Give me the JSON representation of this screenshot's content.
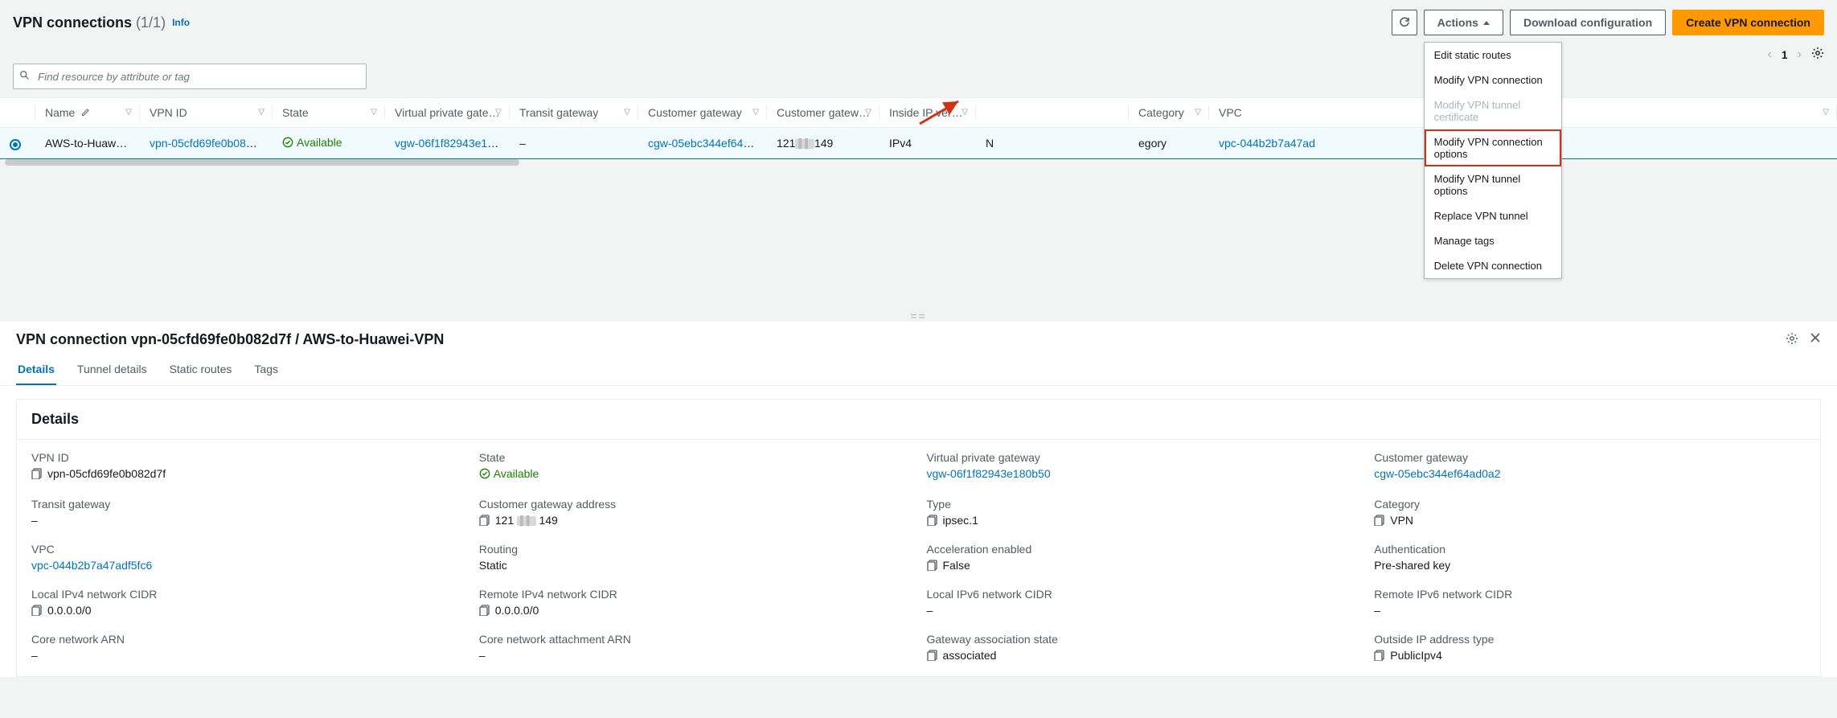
{
  "header": {
    "title": "VPN connections",
    "count": "(1/1)",
    "info": "Info",
    "search_placeholder": "Find resource by attribute or tag",
    "pager": {
      "page": "1"
    }
  },
  "toolbar": {
    "actions": "Actions",
    "download": "Download configuration",
    "create": "Create VPN connection"
  },
  "actions_menu": [
    {
      "label": "Edit static routes",
      "disabled": false
    },
    {
      "label": "Modify VPN connection",
      "disabled": false
    },
    {
      "label": "Modify VPN tunnel certificate",
      "disabled": true
    },
    {
      "label": "Modify VPN connection options",
      "disabled": false,
      "highlight": true
    },
    {
      "label": "Modify VPN tunnel options",
      "disabled": false
    },
    {
      "label": "Replace VPN tunnel",
      "disabled": false
    },
    {
      "label": "Manage tags",
      "disabled": false
    },
    {
      "label": "Delete VPN connection",
      "disabled": false
    }
  ],
  "columns": [
    "Name",
    "VPN ID",
    "State",
    "Virtual private gateway",
    "Transit gateway",
    "Customer gateway",
    "Customer gateway add...",
    "Inside IP version",
    "",
    "Category",
    "VPC"
  ],
  "row": {
    "name": "AWS-to-Huawei-VPN",
    "vpn_id": "vpn-05cfd69fe0b082d7f",
    "state": "Available",
    "vgw": "vgw-06f1f82943e180b50",
    "tgw": "–",
    "cgw": "cgw-05ebc344ef64ad0a2",
    "cgw_addr_a": "121",
    "cgw_addr_b": "149",
    "inside_ip": "IPv4",
    "category_char": "N",
    "category": "egory",
    "vpc": "vpc-044b2b7a47ad"
  },
  "detail": {
    "title": "VPN connection vpn-05cfd69fe0b082d7f / AWS-to-Huawei-VPN",
    "tabs": [
      "Details",
      "Tunnel details",
      "Static routes",
      "Tags"
    ],
    "panel_title": "Details",
    "items": [
      {
        "k": "VPN ID",
        "v": "vpn-05cfd69fe0b082d7f",
        "copy": true
      },
      {
        "k": "State",
        "v": "Available",
        "status": true
      },
      {
        "k": "Virtual private gateway",
        "v": "vgw-06f1f82943e180b50",
        "link": true
      },
      {
        "k": "Customer gateway",
        "v": "cgw-05ebc344ef64ad0a2",
        "link": true
      },
      {
        "k": "Transit gateway",
        "v": "–"
      },
      {
        "k": "Customer gateway address",
        "v": "121  149",
        "copy": true,
        "redact": true,
        "pre": "121",
        "post": "149"
      },
      {
        "k": "Type",
        "v": "ipsec.1",
        "copy": true
      },
      {
        "k": "Category",
        "v": "VPN",
        "copy": true
      },
      {
        "k": "VPC",
        "v": "vpc-044b2b7a47adf5fc6",
        "link": true
      },
      {
        "k": "Routing",
        "v": "Static"
      },
      {
        "k": "Acceleration enabled",
        "v": "False",
        "copy": true
      },
      {
        "k": "Authentication",
        "v": "Pre-shared key"
      },
      {
        "k": "Local IPv4 network CIDR",
        "v": "0.0.0.0/0",
        "copy": true
      },
      {
        "k": "Remote IPv4 network CIDR",
        "v": "0.0.0.0/0",
        "copy": true
      },
      {
        "k": "Local IPv6 network CIDR",
        "v": "–"
      },
      {
        "k": "Remote IPv6 network CIDR",
        "v": "–"
      },
      {
        "k": "Core network ARN",
        "v": "–"
      },
      {
        "k": "Core network attachment ARN",
        "v": "–"
      },
      {
        "k": "Gateway association state",
        "v": "associated",
        "copy": true
      },
      {
        "k": "Outside IP address type",
        "v": "PublicIpv4",
        "copy": true
      }
    ]
  }
}
